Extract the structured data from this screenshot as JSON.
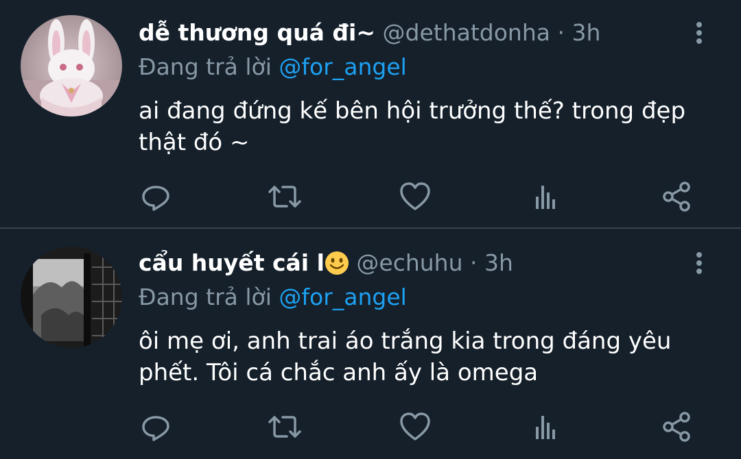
{
  "tweets": [
    {
      "display_name": "dễ thương quá đi~",
      "handle": "@dethatdonha",
      "separator": "·",
      "time": "3h",
      "reply_prefix": "Đang trả lời",
      "reply_to": "@for_angel",
      "text": "ai đang đứng kế bên hội trưởng thế? trong đẹp thật đó ~",
      "avatar": "bunny-plush-avatar",
      "actions": [
        "reply-icon",
        "retweet-icon",
        "like-icon",
        "analytics-icon",
        "share-icon"
      ]
    },
    {
      "display_name": "cẩu huyết cái l",
      "display_name_emoji": "smiling-face-emoji",
      "handle": "@echuhu",
      "separator": "·",
      "time": "3h",
      "reply_prefix": "Đang trả lời",
      "reply_to": "@for_angel",
      "text": "ôi mẹ ơi, anh trai áo trắng kia trong đáng yêu phết. Tôi cá chắc anh ấy là omega",
      "avatar": "snowy-window-avatar",
      "actions": [
        "reply-icon",
        "retweet-icon",
        "like-icon",
        "analytics-icon",
        "share-icon"
      ]
    }
  ],
  "colors": {
    "background": "#15202b",
    "divider": "#38444d",
    "secondary_text": "#8899a6",
    "mention": "#1da1f2",
    "primary_text": "#ffffff"
  }
}
